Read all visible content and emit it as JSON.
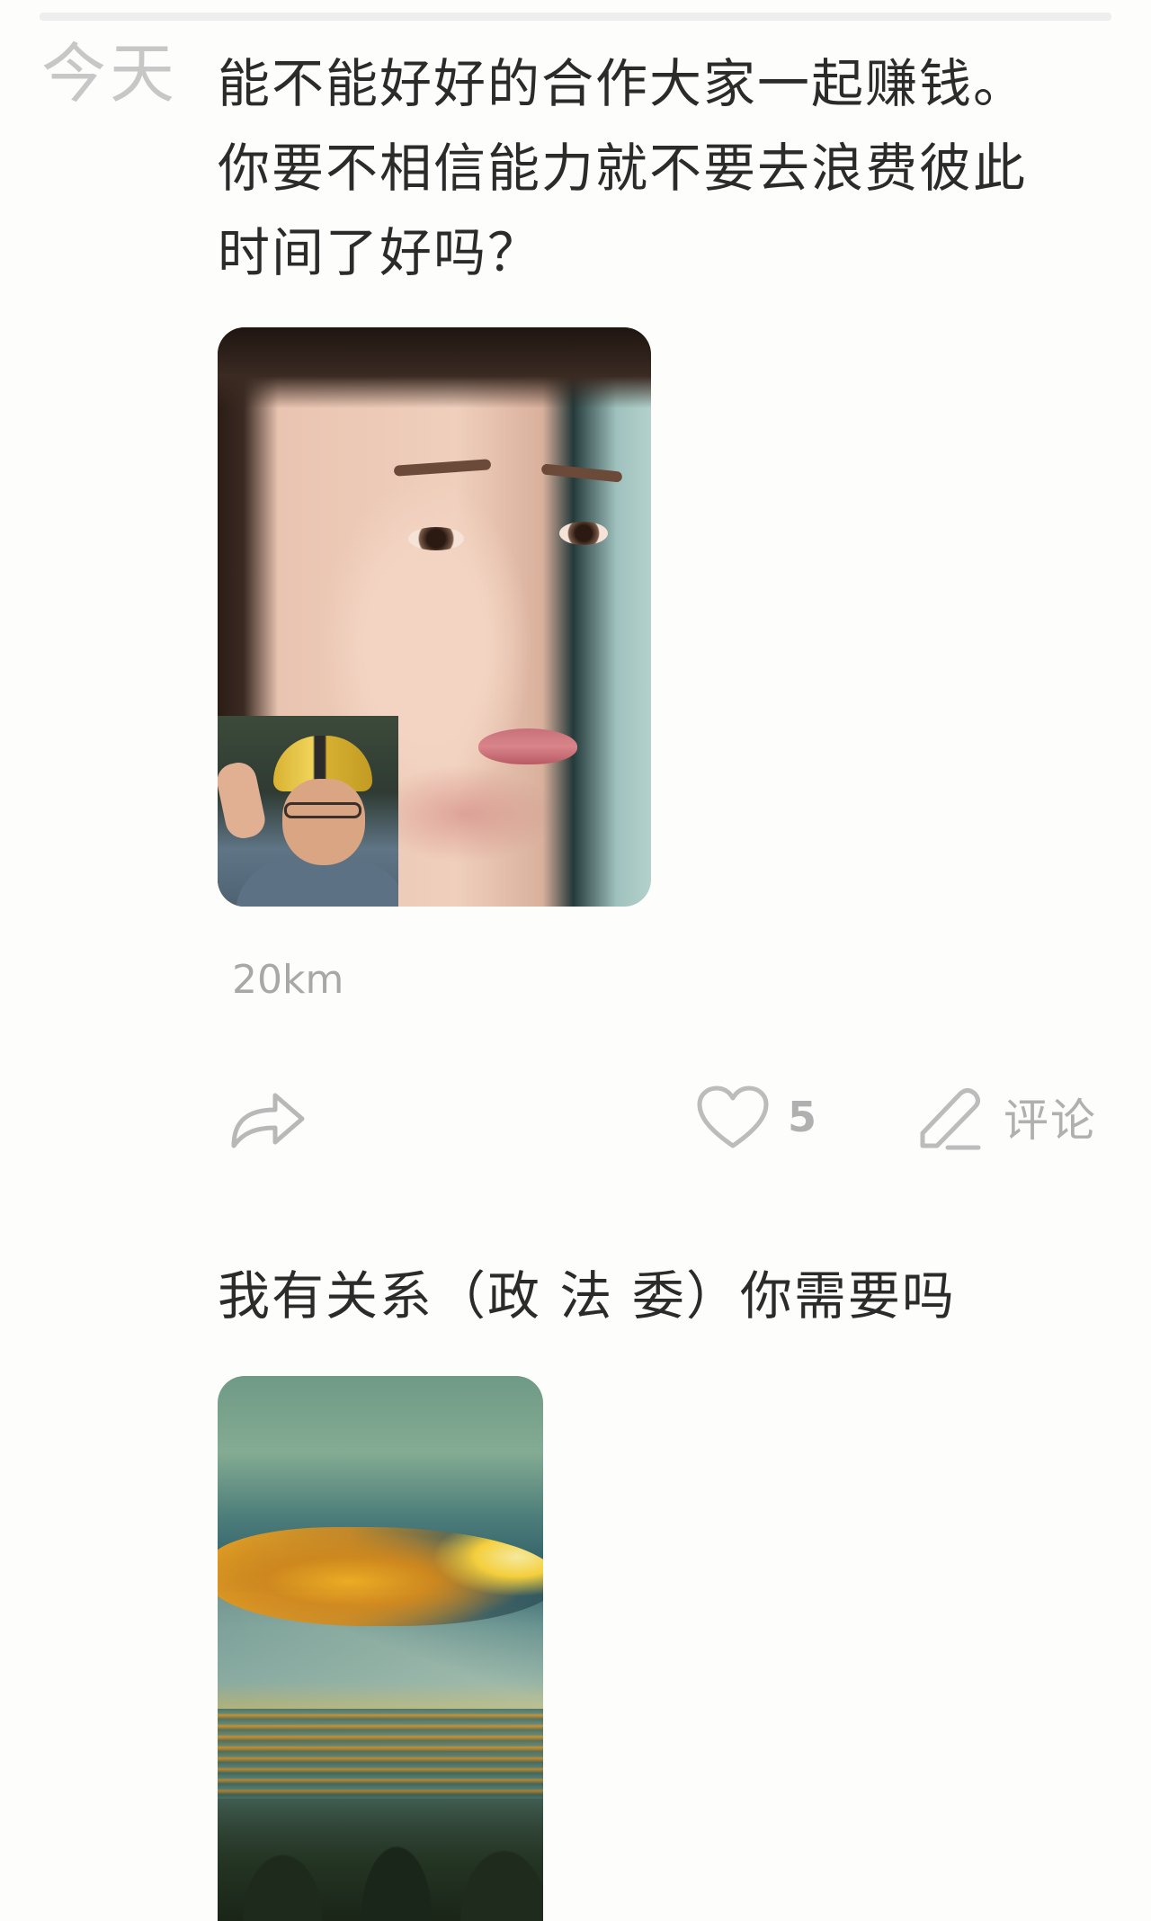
{
  "feed": {
    "date_label": "今天",
    "posts": [
      {
        "text": "能不能好好的合作大家一起赚钱。\n你要不相信能力就不要去浪费彼此\n时间了好吗？",
        "image": "portrait-photo-with-helmet-inset",
        "distance": "20km",
        "actions": {
          "share_icon": "share-arrow-icon",
          "like_icon": "heart-outline-icon",
          "like_count": "5",
          "comment_icon": "pen-icon",
          "comment_label": "评论"
        }
      },
      {
        "text": "我有关系（政 法 委）你需要吗",
        "image": "sunset-over-sea-photo"
      }
    ]
  },
  "colors": {
    "background": "#fdfdfb",
    "primary_text": "#2b2b2b",
    "muted_text": "#a8a8a8",
    "icon_gray": "#b0b0b0"
  }
}
